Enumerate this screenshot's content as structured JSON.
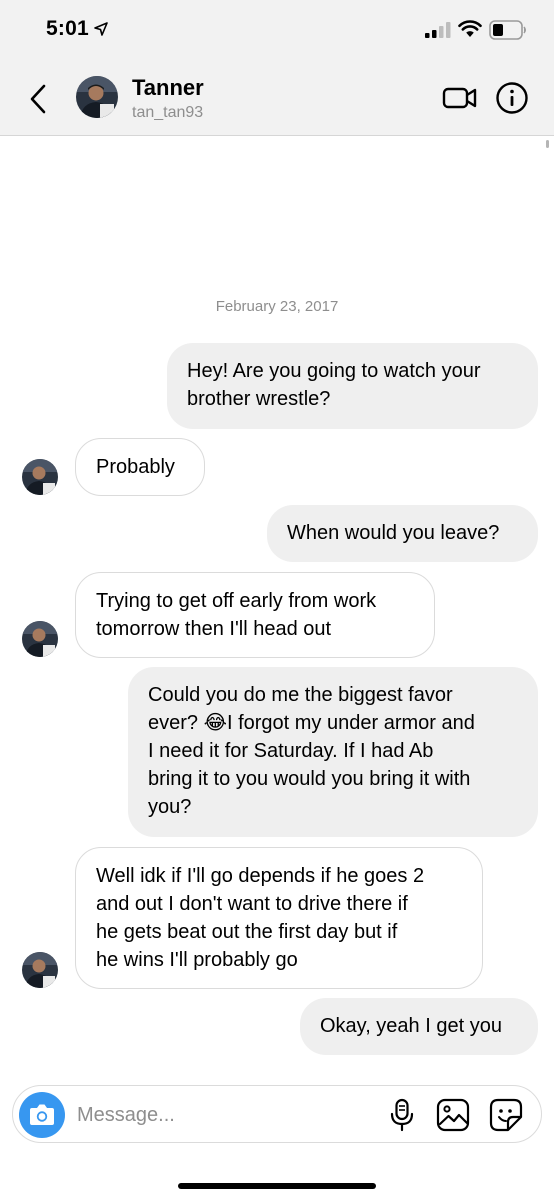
{
  "status_bar": {
    "time": "5:01"
  },
  "header": {
    "name": "Tanner",
    "username": "tan_tan93"
  },
  "conversation": {
    "date": "February 23, 2017",
    "messages": [
      {
        "side": "sent",
        "lines": [
          "Hey! Are you going to watch your",
          "brother wrestle?"
        ]
      },
      {
        "side": "received",
        "lines": [
          "Probably"
        ]
      },
      {
        "side": "sent",
        "lines": [
          "When would you leave?"
        ]
      },
      {
        "side": "received",
        "lines": [
          "Trying to get off early from work",
          "tomorrow then I'll head out"
        ]
      },
      {
        "side": "sent",
        "lines": [
          "Could you do me the biggest favor",
          "ever? 😂I forgot my under armor and",
          "I need it for Saturday. If I had Ab",
          "bring it to you would you bring it with",
          "you?"
        ]
      },
      {
        "side": "received",
        "lines": [
          "Well idk if I'll go depends if he goes 2",
          "and out I don't want to drive there if",
          "he gets beat out the first day but if",
          "he wins I'll probably go"
        ]
      },
      {
        "side": "sent",
        "lines": [
          "Okay, yeah I get you"
        ]
      }
    ]
  },
  "composer": {
    "placeholder": "Message...",
    "value": ""
  },
  "icons": {
    "location": "location-arrow-icon",
    "signal": "signal-icon",
    "wifi": "wifi-icon",
    "battery": "battery-icon",
    "back": "chevron-left-icon",
    "video": "video-camera-icon",
    "info": "info-icon",
    "camera": "camera-icon",
    "mic": "microphone-icon",
    "gallery": "image-icon",
    "sticker": "sticker-icon"
  },
  "colors": {
    "accent": "#3797f0",
    "sent_bubble": "#efefef",
    "bar_bg": "#f2f2f2"
  }
}
